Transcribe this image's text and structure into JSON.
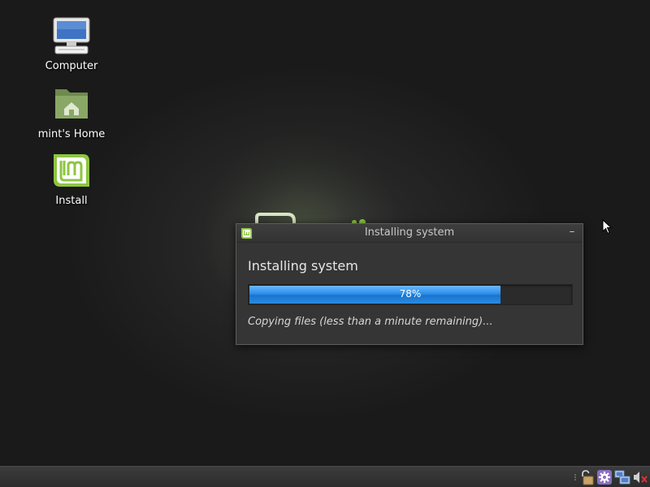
{
  "desktop": {
    "icons": [
      {
        "label": "Computer",
        "icon": "computer-icon"
      },
      {
        "label": "mint's Home",
        "icon": "home-folder-icon"
      },
      {
        "label": "Install",
        "icon": "mint-install-icon"
      }
    ]
  },
  "dialog": {
    "window_title": "Installing system",
    "heading": "Installing system",
    "progress_percent": 78,
    "progress_label": "78%",
    "status_text": "Copying files (less than a minute remaining)...",
    "minimize_glyph": "–"
  },
  "taskbar": {
    "tray_icons": [
      "lock-icon",
      "settings-icon",
      "network-icon",
      "volume-muted-icon"
    ]
  },
  "colors": {
    "progress_fill": "#2b8fe8",
    "mint_green": "#8ec63f",
    "dialog_bg": "#353535"
  }
}
